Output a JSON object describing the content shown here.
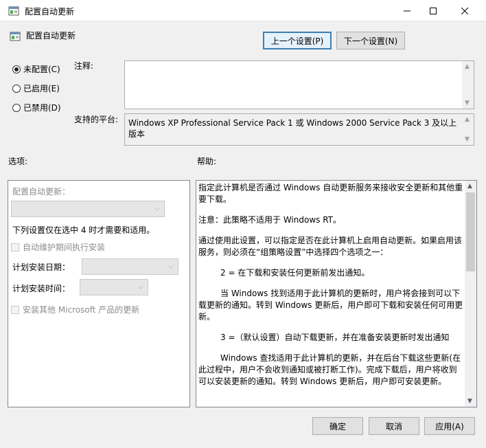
{
  "window": {
    "title": "配置自动更新"
  },
  "header": {
    "title": "配置自动更新",
    "prev_label": "上一个设置(P)",
    "next_label": "下一个设置(N)"
  },
  "state": {
    "options": [
      {
        "label": "未配置(C)",
        "selected": true
      },
      {
        "label": "已启用(E)",
        "selected": false
      },
      {
        "label": "已禁用(D)",
        "selected": false
      }
    ]
  },
  "comment_label": "注释:",
  "platform_label": "支持的平台:",
  "platform_value": "Windows XP Professional Service Pack 1 或 Windows 2000 Service Pack 3 及以上版本",
  "options_label": "选项:",
  "help_label": "帮助:",
  "options_panel": {
    "configure_label": "配置自动更新：",
    "note": "下列设置仅在选中 4 时才需要和适用。",
    "maintenance_checkbox": "自动维护期间执行安装",
    "day_label": "计划安装日期：",
    "time_label": "计划安装时间：",
    "other_products_checkbox": "安装其他 Microsoft 产品的更新"
  },
  "help_text": [
    "指定此计算机是否通过 Windows 自动更新服务来接收安全更新和其他重要下载。",
    "注意：此策略不适用于 Windows RT。",
    "通过使用此设置，可以指定是否在此计算机上启用自动更新。如果启用该服务，则必须在“组策略设置”中选择四个选项之一：",
    "2 = 在下载和安装任何更新前发出通知。",
    "当 Windows 找到适用于此计算机的更新时，用户将会接到可以下载更新的通知。转到 Windows 更新后，用户即可下载和安装任何可用更新。",
    "3 =（默认设置）自动下载更新，并在准备安装更新时发出通知",
    "Windows 查找适用于此计算机的更新，并在后台下载这些更新(在此过程中，用户不会收到通知或被打断工作)。完成下载后，用户将收到可以安装更新的通知。转到 Windows 更新后，用户即可安装更新。"
  ],
  "footer": {
    "ok_label": "确定",
    "cancel_label": "取消",
    "apply_label": "应用(A)"
  }
}
